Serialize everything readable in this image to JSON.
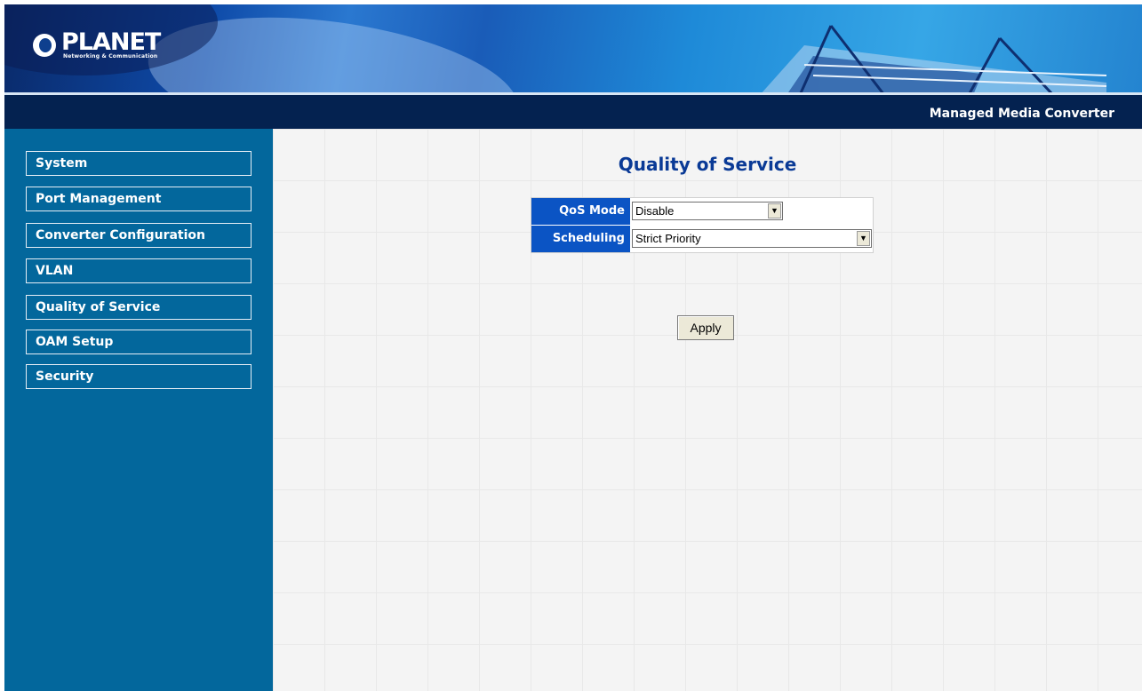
{
  "header": {
    "logo_text": "PLANET",
    "logo_subtitle": "Networking & Communication",
    "product_name": "Managed Media Converter"
  },
  "sidebar": {
    "items": [
      {
        "label": "System"
      },
      {
        "label": "Port Management"
      },
      {
        "label": "Converter Configuration"
      },
      {
        "label": "VLAN"
      },
      {
        "label": "Quality of Service"
      },
      {
        "label": "OAM Setup"
      },
      {
        "label": "Security"
      }
    ]
  },
  "main": {
    "title": "Quality of Service",
    "qos_mode": {
      "label": "QoS Mode",
      "value": "Disable"
    },
    "scheduling": {
      "label": "Scheduling",
      "value": "Strict Priority"
    },
    "apply_label": "Apply"
  },
  "colors": {
    "banner_dark": "#042250",
    "sidebar_bg": "#03679c",
    "label_bg": "#0b54c4",
    "title_text": "#0a3a96"
  },
  "icons": {
    "dropdown": "chevron-down-icon",
    "logo": "planet-logo-icon"
  }
}
